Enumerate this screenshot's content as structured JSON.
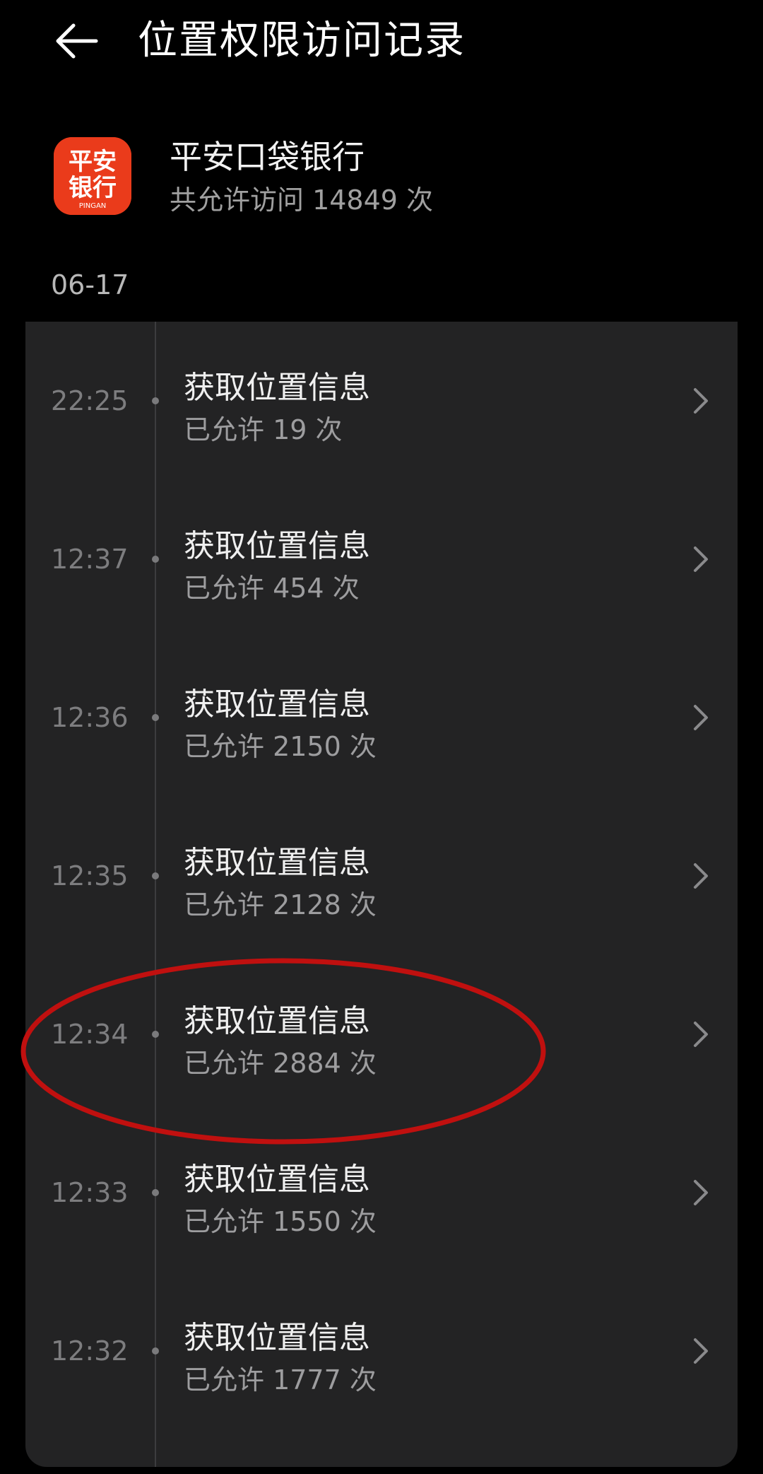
{
  "header": {
    "title": "位置权限访问记录",
    "back_icon": "arrow-left-icon"
  },
  "app": {
    "name": "平安口袋银行",
    "count_text": "共允许访问 14849 次",
    "logo": {
      "line1": "平安",
      "line2": "银行",
      "caption": "PINGAN",
      "color": "#ea3b1b"
    }
  },
  "date": "06-17",
  "records": [
    {
      "time": "22:25",
      "title": "获取位置信息",
      "subtitle": "已允许 19 次"
    },
    {
      "time": "12:37",
      "title": "获取位置信息",
      "subtitle": "已允许 454 次"
    },
    {
      "time": "12:36",
      "title": "获取位置信息",
      "subtitle": "已允许 2150 次"
    },
    {
      "time": "12:35",
      "title": "获取位置信息",
      "subtitle": "已允许 2128 次"
    },
    {
      "time": "12:34",
      "title": "获取位置信息",
      "subtitle": "已允许 2884 次",
      "highlighted": true
    },
    {
      "time": "12:33",
      "title": "获取位置信息",
      "subtitle": "已允许 1550 次"
    },
    {
      "time": "12:32",
      "title": "获取位置信息",
      "subtitle": "已允许 1777 次"
    }
  ],
  "colors": {
    "background": "#000000",
    "card": "#232324",
    "annotation": "#c0100f"
  }
}
